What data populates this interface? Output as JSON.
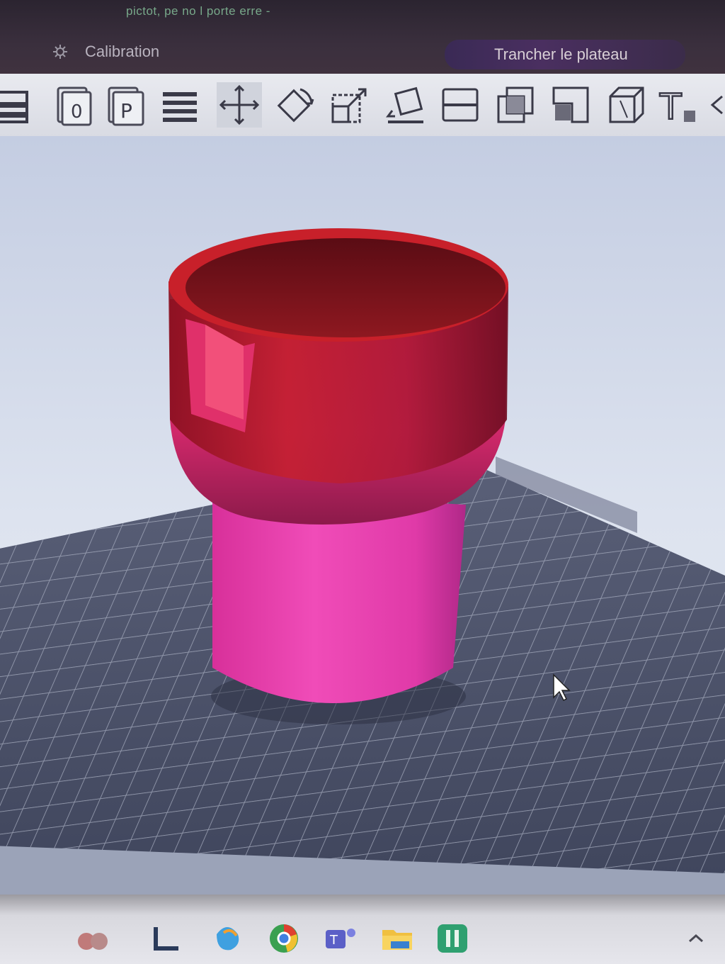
{
  "window": {
    "title": "pictot, pe no l porte erre -",
    "calibration_label": "Calibration",
    "calibration_icon": "gear-icon",
    "slice_button_label": "Trancher le plateau"
  },
  "toolbar": {
    "tools": [
      {
        "name": "arrange-icon"
      },
      {
        "name": "object-list-icon"
      },
      {
        "name": "plate-icon"
      },
      {
        "name": "layers-icon"
      },
      {
        "name": "move-icon"
      },
      {
        "name": "rotate-icon"
      },
      {
        "name": "scale-icon"
      },
      {
        "name": "lay-on-face-icon"
      },
      {
        "name": "cut-icon"
      },
      {
        "name": "boolean-icon"
      },
      {
        "name": "support-paint-icon"
      },
      {
        "name": "seam-paint-icon"
      },
      {
        "name": "text-icon"
      }
    ]
  },
  "viewport": {
    "model_color_top": "#c8202a",
    "model_color_bottom": "#e63ba3",
    "bed_color": "#4a5068",
    "background": "#c8d2e6"
  },
  "taskbar": {
    "apps": [
      {
        "name": "widgets-icon"
      },
      {
        "name": "app-l-icon"
      },
      {
        "name": "copilot-icon"
      },
      {
        "name": "chrome-icon"
      },
      {
        "name": "teams-icon"
      },
      {
        "name": "file-explorer-icon"
      },
      {
        "name": "green-app-icon"
      }
    ],
    "tray_icon": "chevron-up-icon"
  }
}
